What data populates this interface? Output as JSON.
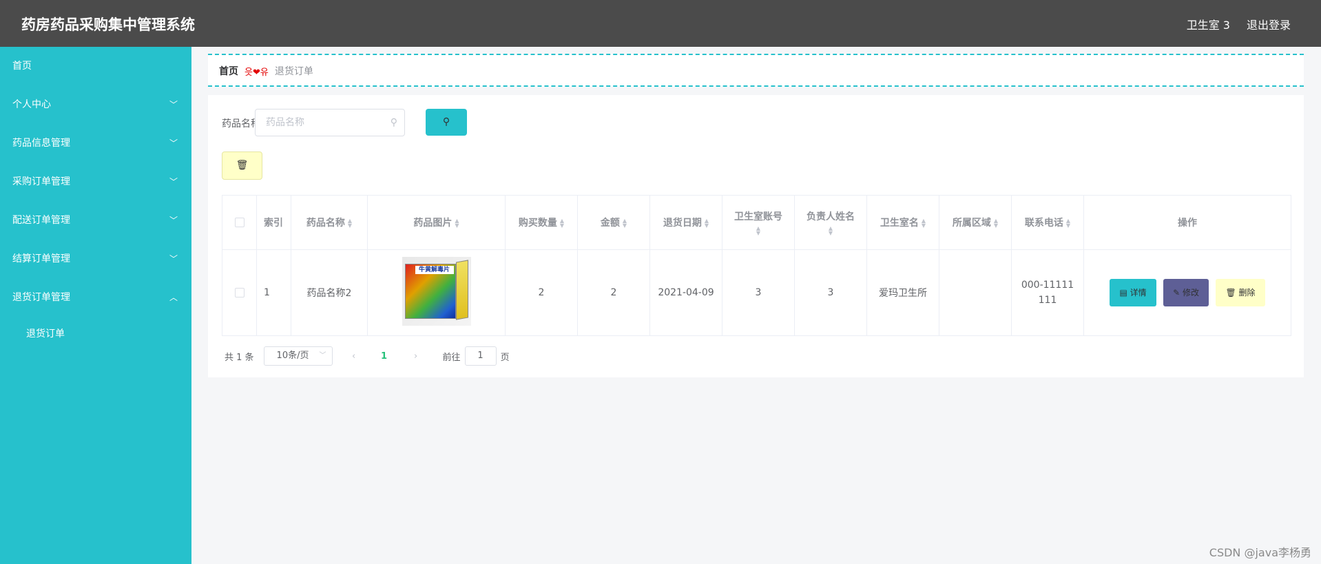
{
  "app": {
    "title": "药房药品采购集中管理系统"
  },
  "topbar": {
    "user": "卫生室 3",
    "logout": "退出登录"
  },
  "sidebar": {
    "items": [
      {
        "label": "首页",
        "chevron": ""
      },
      {
        "label": "个人中心",
        "chevron": "﹀"
      },
      {
        "label": "药品信息管理",
        "chevron": "﹀"
      },
      {
        "label": "采购订单管理",
        "chevron": "﹀"
      },
      {
        "label": "配送订单管理",
        "chevron": "﹀"
      },
      {
        "label": "结算订单管理",
        "chevron": "﹀"
      },
      {
        "label": "退货订单管理",
        "chevron": "︿"
      }
    ],
    "sub_item": "退货订单"
  },
  "breadcrumb": {
    "home": "首页",
    "separator": "읏❤유",
    "current": "退货订单"
  },
  "search": {
    "label": "药品名称",
    "placeholder": "药品名称",
    "button_icon": "⚲"
  },
  "toolbar": {
    "delete_icon": "🗑"
  },
  "table": {
    "headers": {
      "index": "索引",
      "name": "药品名称",
      "image": "药品图片",
      "qty": "购买数量",
      "amount": "金额",
      "date": "退货日期",
      "account": "卫生室账号",
      "person": "负责人姓名",
      "clinic": "卫生室名",
      "area": "所属区域",
      "phone": "联系电话",
      "ops": "操作"
    },
    "rows": [
      {
        "index": "1",
        "name": "药品名称2",
        "image_label": "牛黄解毒片",
        "qty": "2",
        "amount": "2",
        "date": "2021-04-09",
        "account": "3",
        "person": "3",
        "clinic": "爱玛卫生所",
        "area": "",
        "phone": "000-11111111"
      }
    ],
    "ops": {
      "detail": "详情",
      "edit": "修改",
      "delete": "删除"
    }
  },
  "pagination": {
    "total": "共 1 条",
    "page_size": "10条/页",
    "prev": "‹",
    "current": "1",
    "next": "›",
    "goto_prefix": "前往",
    "goto_value": "1",
    "goto_suffix": "页"
  },
  "watermark": "CSDN @java李杨勇",
  "colors": {
    "accent": "#26c1cc",
    "topbar": "#4b4b4b",
    "edit": "#5e5f96",
    "delete": "#ffffc8"
  }
}
